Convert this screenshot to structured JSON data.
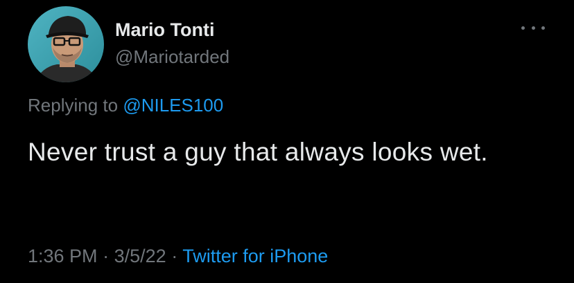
{
  "tweet": {
    "author": {
      "name": "Mario Tonti",
      "handle": "@Mariotarded"
    },
    "replying_to_prefix": "Replying to",
    "replying_to_handle": "@NILES100",
    "text": "Never trust a guy that always looks wet.",
    "time": "1:36 PM",
    "separator": "·",
    "date": "3/5/22",
    "source": "Twitter for iPhone"
  },
  "icons": {
    "more": "more-horizontal-icon"
  },
  "colors": {
    "background": "#000000",
    "primary_text": "#e7e9ea",
    "secondary_text": "#71767b",
    "link": "#1d9bf0"
  }
}
